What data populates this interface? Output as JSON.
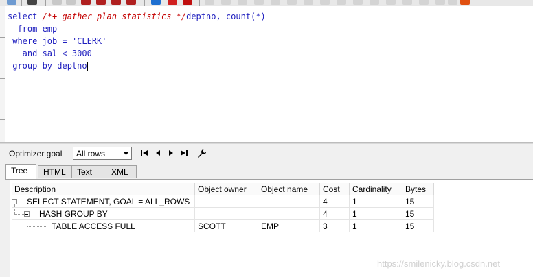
{
  "editor": {
    "lines": [
      {
        "segments": [
          {
            "t": "select ",
            "c": "kw"
          },
          {
            "t": "/*+ gather_plan_statistics */",
            "c": "cmt"
          },
          {
            "t": "deptno, ",
            "c": "plain"
          },
          {
            "t": "count",
            "c": "kw"
          },
          {
            "t": "(*)",
            "c": "plain"
          }
        ]
      },
      {
        "segments": [
          {
            "t": "  from ",
            "c": "kw"
          },
          {
            "t": "emp",
            "c": "plain"
          }
        ]
      },
      {
        "segments": [
          {
            "t": " where ",
            "c": "kw"
          },
          {
            "t": "job = ",
            "c": "plain"
          },
          {
            "t": "'CLERK'",
            "c": "str"
          }
        ]
      },
      {
        "segments": [
          {
            "t": "   and ",
            "c": "kw"
          },
          {
            "t": "sal < 3000",
            "c": "plain"
          }
        ]
      },
      {
        "segments": [
          {
            "t": " group by ",
            "c": "kw"
          },
          {
            "t": "deptno",
            "c": "plain"
          }
        ]
      }
    ]
  },
  "goal": {
    "label": "Optimizer goal",
    "selected": "All rows"
  },
  "tabs": [
    {
      "label": "Tree",
      "active": true
    },
    {
      "label": "HTML",
      "active": false
    },
    {
      "label": "Text",
      "active": false
    },
    {
      "label": "XML",
      "active": false
    }
  ],
  "grid": {
    "columns": [
      "Description",
      "Object owner",
      "Object name",
      "Cost",
      "Cardinality",
      "Bytes"
    ],
    "rows": [
      {
        "description": "SELECT STATEMENT, GOAL = ALL_ROWS",
        "owner": "",
        "name": "",
        "cost": "4",
        "cardinality": "1",
        "bytes": "15"
      },
      {
        "description": "HASH GROUP BY",
        "owner": "",
        "name": "",
        "cost": "4",
        "cardinality": "1",
        "bytes": "15"
      },
      {
        "description": "TABLE ACCESS FULL",
        "owner": "SCOTT",
        "name": "EMP",
        "cost": "3",
        "cardinality": "1",
        "bytes": "15"
      }
    ]
  },
  "watermark": "https://smilenicky.blog.csdn.net",
  "colors": {
    "keyword": "#1f1fbf",
    "comment": "#c40000"
  }
}
